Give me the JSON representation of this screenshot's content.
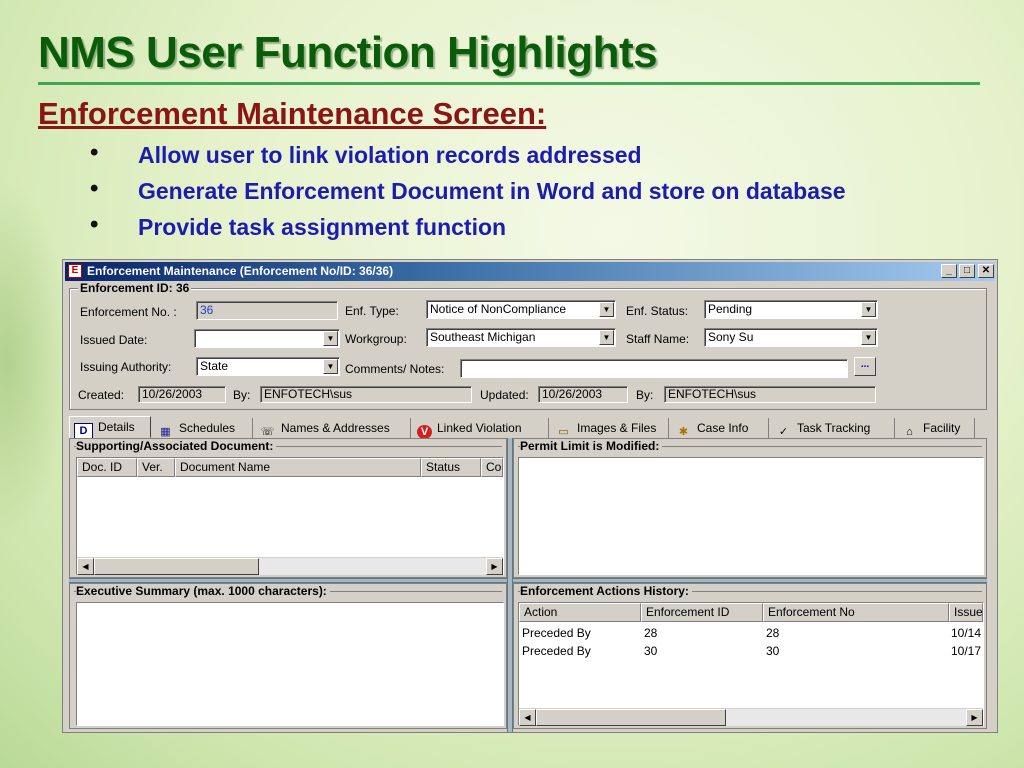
{
  "slide": {
    "title": "NMS User Function Highlights",
    "subtitle": "Enforcement Maintenance Screen:",
    "bullet_glyph": "•",
    "bullets": [
      "Allow user to link violation records addressed",
      "Generate Enforcement Document in Word and store on database",
      "Provide task assignment function"
    ]
  },
  "window": {
    "title": "Enforcement Maintenance (Enforcement No/ID: 36/36)",
    "app_icon_glyph": "E",
    "minimize_glyph": "_",
    "maximize_glyph": "□",
    "close_glyph": "✕"
  },
  "header_group": {
    "caption": "Enforcement ID: 36",
    "enforcement_no_label": "Enforcement No. :",
    "enforcement_no_value": "36",
    "enf_type_label": "Enf. Type:",
    "enf_type_value": "Notice of NonCompliance",
    "enf_status_label": "Enf. Status:",
    "enf_status_value": "Pending",
    "issued_date_label": "Issued Date:",
    "issued_date_value": "",
    "workgroup_label": "Workgroup:",
    "workgroup_value": "Southeast Michigan",
    "staff_name_label": "Staff Name:",
    "staff_name_value": "Sony Su",
    "issuing_authority_label": "Issuing Authority:",
    "issuing_authority_value": "State",
    "comments_label": "Comments/ Notes:",
    "comments_value": "",
    "ellipsis_label": "...",
    "created_label": "Created:",
    "created_value": "10/26/2003",
    "created_by_label": "By:",
    "created_by_value": "ENFOTECH\\sus",
    "updated_label": "Updated:",
    "updated_value": "10/26/2003",
    "updated_by_label": "By:",
    "updated_by_value": "ENFOTECH\\sus",
    "dropdown_glyph": "▼"
  },
  "tabs": [
    {
      "label": "Details",
      "icon": "details-icon",
      "glyph": "D"
    },
    {
      "label": "Schedules",
      "icon": "calendar-icon",
      "glyph": "▦"
    },
    {
      "label": "Names & Addresses",
      "icon": "address-card-icon",
      "glyph": "☏"
    },
    {
      "label": "Linked Violation",
      "icon": "violation-icon",
      "glyph": "V"
    },
    {
      "label": "Images & Files",
      "icon": "folder-images-icon",
      "glyph": "▭"
    },
    {
      "label": "Case Info",
      "icon": "case-info-icon",
      "glyph": "✱"
    },
    {
      "label": "Task Tracking",
      "icon": "task-tracking-icon",
      "glyph": "✓"
    },
    {
      "label": "Facility",
      "icon": "factory-icon",
      "glyph": "⌂"
    }
  ],
  "supporting_docs": {
    "caption": "Supporting/Associated Document:",
    "columns": [
      "Doc. ID",
      "Ver.",
      "Document Name",
      "Status",
      "Co"
    ]
  },
  "permit_limit": {
    "caption": "Permit Limit is Modified:"
  },
  "executive_summary": {
    "caption": "Executive Summary (max. 1000 characters):"
  },
  "actions_history": {
    "caption": "Enforcement Actions History:",
    "columns": [
      "Action",
      "Enforcement ID",
      "Enforcement No",
      "Issue"
    ],
    "rows": [
      [
        "Preceded By",
        "28",
        "28",
        "10/14"
      ],
      [
        "Preceded By",
        "30",
        "30",
        "10/17"
      ]
    ]
  },
  "scroll": {
    "left_glyph": "◀",
    "right_glyph": "▶"
  }
}
